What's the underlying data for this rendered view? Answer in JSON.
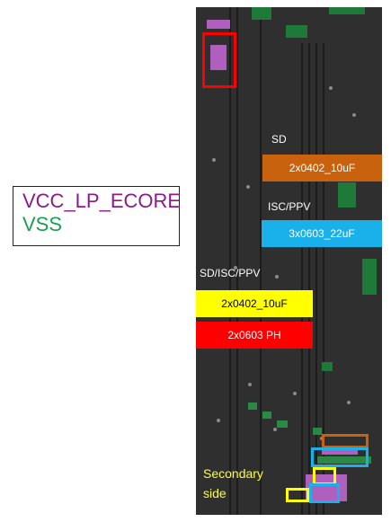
{
  "legend": {
    "line1": "VCC_LP_ECORE",
    "line2": "VSS"
  },
  "labels": {
    "sd": "SD",
    "isc_ppv": "ISC/PPV",
    "sd_isc_ppv": "SD/ISC/PPV",
    "secondary_side": "Secondary\nside"
  },
  "caps": {
    "orange": "2x0402_10uF",
    "blue": "3x0603_22uF",
    "yellow": "2x0402_10uF",
    "red": "2x0603 PH"
  },
  "colors": {
    "vcc": "#8b1a8b",
    "vss": "#19a050",
    "orange": "#c8620f",
    "blue": "#1ab0ea",
    "yellow": "#ffff00",
    "red": "#ff0000",
    "board": "#2f2f2f"
  }
}
